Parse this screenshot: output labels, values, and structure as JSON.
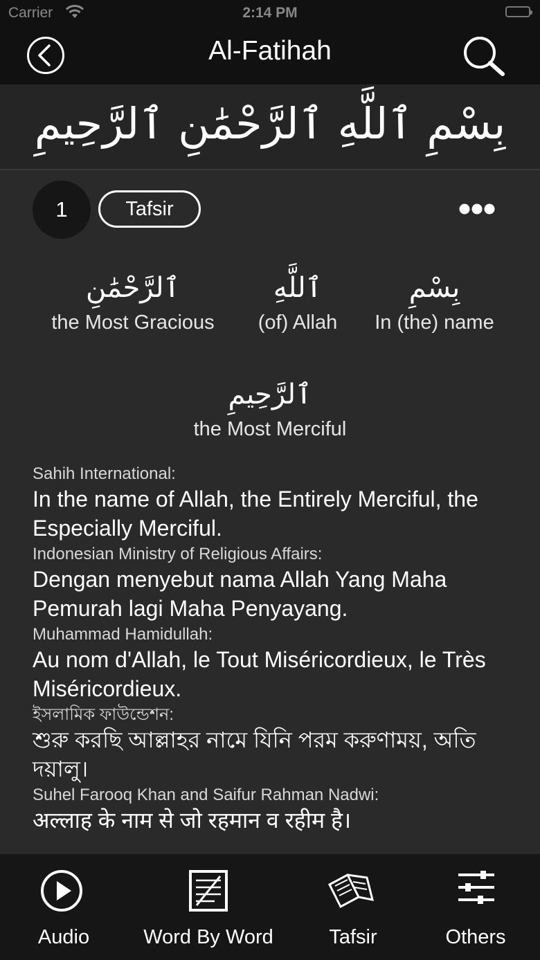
{
  "status": {
    "carrier": "Carrier",
    "time": "2:14 PM"
  },
  "nav": {
    "title": "Al-Fatihah",
    "back_icon": "chevron-left-circle-icon",
    "search_icon": "search-icon"
  },
  "basmala": "بِسْمِ ٱللَّهِ ٱلرَّحْمَٰنِ ٱلرَّحِيمِ",
  "verse": {
    "number": "1",
    "tafsir_label": "Tafsir",
    "words": [
      {
        "arabic": "بِسْمِ",
        "translation": "In (the) name"
      },
      {
        "arabic": "ٱللَّهِ",
        "translation": "(of) Allah"
      },
      {
        "arabic": "ٱلرَّحْمَٰنِ",
        "translation": "the Most Gracious"
      },
      {
        "arabic": "ٱلرَّحِيمِ",
        "translation": "the Most Merciful"
      }
    ],
    "translations": [
      {
        "source": "Sahih International:",
        "text": "In the name of Allah, the Entirely Merciful, the Especially Merciful."
      },
      {
        "source": "Indonesian Ministry of Religious Affairs:",
        "text": "Dengan menyebut nama Allah Yang Maha Pemurah lagi Maha Penyayang."
      },
      {
        "source": "Muhammad Hamidullah:",
        "text": "Au nom d'Allah, le Tout Miséricordieux, le Très Miséricordieux."
      },
      {
        "source": "ইসলামিক ফাউন্ডেশন:",
        "text": "শুরু করছি আল্লাহর নামে যিনি পরম করুণাময়, অতি দয়ালু।"
      },
      {
        "source": "Suhel Farooq Khan and Saifur Rahman Nadwi:",
        "text": "अल्लाह के नाम से जो रहमान व रहीम है।"
      }
    ]
  },
  "tabs": [
    {
      "label": "Audio",
      "icon": "play-circle-icon"
    },
    {
      "label": "Word By Word",
      "icon": "word-by-word-icon"
    },
    {
      "label": "Tafsir",
      "icon": "open-book-icon"
    },
    {
      "label": "Others",
      "icon": "sliders-icon"
    }
  ]
}
